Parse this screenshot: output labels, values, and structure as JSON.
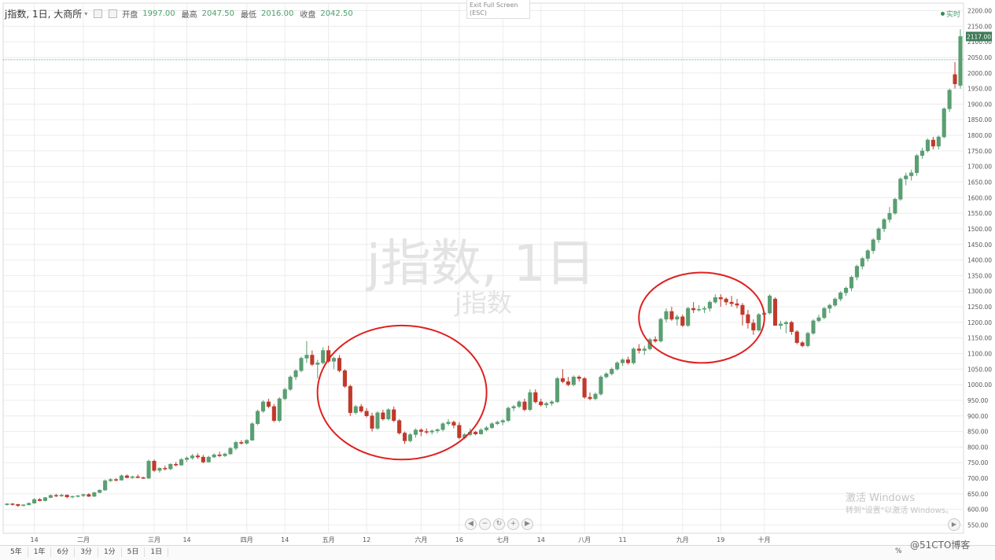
{
  "header": {
    "symbol": "j指数, 1日, 大商所",
    "open_label": "开盘",
    "open_value": "1997.00",
    "high_label": "最高",
    "high_value": "2047.50",
    "low_label": "最低",
    "low_value": "2016.00",
    "close_label": "收盘",
    "close_value": "2042.50"
  },
  "exit_fullscreen": {
    "line1": "Exit Full Screen",
    "line2": "(ESC)"
  },
  "realtime_label": "实时",
  "watermark": {
    "main": "j指数, 1日",
    "sub": "j指数"
  },
  "last_price_label": "2117.00",
  "timeframes": [
    "5年",
    "1年",
    "6分",
    "3分",
    "1分",
    "5日",
    "1日"
  ],
  "percent_label": "%",
  "windows_activation": {
    "line1": "激活 Windows",
    "line2": "转到\"设置\"以激活 Windows。"
  },
  "blog_watermark": "@51CTO博客",
  "colors": {
    "up": "#5a9e72",
    "down": "#c0392b",
    "circle": "#e02020",
    "grid": "#ececec",
    "last_line": "#6aaea0"
  },
  "chart_data": {
    "type": "candlestick",
    "title": "j指数, 1日, 大商所",
    "ylim": [
      540,
      2210
    ],
    "y_ticks": [
      550,
      600,
      650,
      700,
      750,
      800,
      850,
      900,
      950,
      1000,
      1050,
      1100,
      1150,
      1200,
      1250,
      1300,
      1350,
      1400,
      1450,
      1500,
      1550,
      1600,
      1650,
      1700,
      1750,
      1800,
      1850,
      1900,
      1950,
      2000,
      2050,
      2100,
      2150,
      2200
    ],
    "y_tick_labels": [
      "550.00",
      "600.00",
      "650.00",
      "700.00",
      "750.00",
      "800.00",
      "850.00",
      "900.00",
      "950.00",
      "1000.00",
      "1050.00",
      "1100.00",
      "1150.00",
      "1200.00",
      "1250.00",
      "1300.00",
      "1350.00",
      "1400.00",
      "1450.00",
      "1500.00",
      "1550.00",
      "1600.00",
      "1650.00",
      "1700.00",
      "1750.00",
      "1800.00",
      "1850.00",
      "1900.00",
      "1950.00",
      "2000.00",
      "2050.00",
      "2100.00",
      "2150.00",
      "2200.00"
    ],
    "x_labels": [
      {
        "label": "14",
        "bar": 5
      },
      {
        "label": "二月",
        "bar": 14
      },
      {
        "label": "三月",
        "bar": 27
      },
      {
        "label": "14",
        "bar": 33
      },
      {
        "label": "四月",
        "bar": 44
      },
      {
        "label": "14",
        "bar": 51
      },
      {
        "label": "五月",
        "bar": 59
      },
      {
        "label": "12",
        "bar": 66
      },
      {
        "label": "六月",
        "bar": 76
      },
      {
        "label": "16",
        "bar": 83
      },
      {
        "label": "七月",
        "bar": 91
      },
      {
        "label": "14",
        "bar": 98
      },
      {
        "label": "八月",
        "bar": 106
      },
      {
        "label": "11",
        "bar": 113
      },
      {
        "label": "九月",
        "bar": 124
      },
      {
        "label": "19",
        "bar": 131
      },
      {
        "label": "十月",
        "bar": 139
      }
    ],
    "last_price": 2117,
    "reference_line": 2042.5,
    "candles": [
      [
        615,
        620,
        612,
        618
      ],
      [
        618,
        620,
        612,
        616
      ],
      [
        616,
        618,
        608,
        612
      ],
      [
        612,
        616,
        610,
        615
      ],
      [
        615,
        622,
        612,
        620
      ],
      [
        620,
        636,
        618,
        632
      ],
      [
        632,
        636,
        626,
        628
      ],
      [
        628,
        640,
        626,
        638
      ],
      [
        638,
        648,
        636,
        645
      ],
      [
        645,
        650,
        640,
        643
      ],
      [
        643,
        650,
        640,
        646
      ],
      [
        646,
        648,
        636,
        640
      ],
      [
        640,
        644,
        636,
        642
      ],
      [
        642,
        646,
        638,
        644
      ],
      [
        644,
        650,
        640,
        648
      ],
      [
        648,
        652,
        640,
        642
      ],
      [
        642,
        656,
        640,
        654
      ],
      [
        654,
        664,
        652,
        662
      ],
      [
        662,
        696,
        660,
        692
      ],
      [
        692,
        700,
        688,
        696
      ],
      [
        696,
        700,
        690,
        694
      ],
      [
        694,
        712,
        692,
        708
      ],
      [
        708,
        712,
        700,
        702
      ],
      [
        702,
        708,
        698,
        705
      ],
      [
        705,
        712,
        700,
        702
      ],
      [
        702,
        705,
        698,
        700
      ],
      [
        700,
        760,
        698,
        755
      ],
      [
        755,
        760,
        720,
        725
      ],
      [
        725,
        735,
        718,
        732
      ],
      [
        732,
        740,
        725,
        730
      ],
      [
        730,
        748,
        726,
        745
      ],
      [
        745,
        752,
        738,
        742
      ],
      [
        742,
        765,
        740,
        760
      ],
      [
        760,
        770,
        752,
        765
      ],
      [
        765,
        778,
        760,
        772
      ],
      [
        772,
        780,
        762,
        768
      ],
      [
        768,
        775,
        748,
        752
      ],
      [
        752,
        772,
        750,
        768
      ],
      [
        768,
        780,
        765,
        775
      ],
      [
        775,
        785,
        768,
        772
      ],
      [
        772,
        782,
        768,
        778
      ],
      [
        778,
        800,
        775,
        796
      ],
      [
        796,
        820,
        790,
        815
      ],
      [
        815,
        822,
        808,
        812
      ],
      [
        812,
        825,
        808,
        822
      ],
      [
        822,
        880,
        820,
        875
      ],
      [
        875,
        920,
        870,
        915
      ],
      [
        915,
        950,
        910,
        945
      ],
      [
        945,
        955,
        925,
        930
      ],
      [
        930,
        938,
        880,
        885
      ],
      [
        885,
        960,
        880,
        955
      ],
      [
        955,
        990,
        950,
        985
      ],
      [
        985,
        1030,
        980,
        1025
      ],
      [
        1025,
        1050,
        1015,
        1045
      ],
      [
        1045,
        1090,
        1040,
        1085
      ],
      [
        1085,
        1140,
        1070,
        1095
      ],
      [
        1095,
        1110,
        1060,
        1065
      ],
      [
        1065,
        1080,
        1020,
        1070
      ],
      [
        1070,
        1120,
        1065,
        1110
      ],
      [
        1110,
        1125,
        1070,
        1075
      ],
      [
        1075,
        1090,
        1050,
        1085
      ],
      [
        1085,
        1095,
        1040,
        1045
      ],
      [
        1045,
        1050,
        990,
        995
      ],
      [
        995,
        1000,
        900,
        910
      ],
      [
        910,
        935,
        905,
        930
      ],
      [
        930,
        938,
        910,
        915
      ],
      [
        915,
        925,
        895,
        900
      ],
      [
        900,
        910,
        850,
        860
      ],
      [
        860,
        915,
        855,
        910
      ],
      [
        910,
        920,
        885,
        890
      ],
      [
        890,
        925,
        885,
        920
      ],
      [
        920,
        930,
        880,
        885
      ],
      [
        885,
        890,
        840,
        845
      ],
      [
        845,
        850,
        810,
        820
      ],
      [
        820,
        845,
        815,
        840
      ],
      [
        840,
        860,
        830,
        855
      ],
      [
        855,
        860,
        835,
        850
      ],
      [
        850,
        860,
        842,
        848
      ],
      [
        848,
        856,
        840,
        852
      ],
      [
        852,
        860,
        845,
        856
      ],
      [
        856,
        880,
        850,
        875
      ],
      [
        875,
        890,
        868,
        880
      ],
      [
        880,
        885,
        860,
        870
      ],
      [
        870,
        880,
        825,
        830
      ],
      [
        830,
        845,
        825,
        840
      ],
      [
        840,
        860,
        835,
        848
      ],
      [
        848,
        852,
        838,
        842
      ],
      [
        842,
        860,
        840,
        855
      ],
      [
        855,
        868,
        850,
        862
      ],
      [
        862,
        880,
        858,
        875
      ],
      [
        875,
        885,
        870,
        880
      ],
      [
        880,
        890,
        870,
        885
      ],
      [
        885,
        930,
        880,
        925
      ],
      [
        925,
        935,
        915,
        930
      ],
      [
        930,
        950,
        925,
        945
      ],
      [
        945,
        955,
        915,
        920
      ],
      [
        920,
        985,
        915,
        975
      ],
      [
        975,
        985,
        940,
        945
      ],
      [
        945,
        955,
        930,
        935
      ],
      [
        935,
        945,
        925,
        940
      ],
      [
        940,
        950,
        932,
        945
      ],
      [
        945,
        1025,
        942,
        1020
      ],
      [
        1020,
        1050,
        1005,
        1010
      ],
      [
        1010,
        1025,
        995,
        1000
      ],
      [
        1000,
        1030,
        995,
        1025
      ],
      [
        1025,
        1030,
        1010,
        1020
      ],
      [
        1020,
        1025,
        955,
        960
      ],
      [
        960,
        975,
        950,
        955
      ],
      [
        955,
        975,
        950,
        970
      ],
      [
        970,
        1030,
        965,
        1025
      ],
      [
        1025,
        1040,
        1020,
        1035
      ],
      [
        1035,
        1055,
        1030,
        1050
      ],
      [
        1050,
        1075,
        1045,
        1070
      ],
      [
        1070,
        1085,
        1060,
        1080
      ],
      [
        1080,
        1090,
        1065,
        1070
      ],
      [
        1070,
        1120,
        1065,
        1115
      ],
      [
        1115,
        1130,
        1100,
        1110
      ],
      [
        1110,
        1125,
        1095,
        1115
      ],
      [
        1115,
        1150,
        1110,
        1145
      ],
      [
        1145,
        1155,
        1135,
        1140
      ],
      [
        1140,
        1215,
        1135,
        1210
      ],
      [
        1210,
        1245,
        1200,
        1235
      ],
      [
        1235,
        1250,
        1205,
        1210
      ],
      [
        1210,
        1225,
        1190,
        1218
      ],
      [
        1218,
        1225,
        1185,
        1190
      ],
      [
        1190,
        1250,
        1185,
        1245
      ],
      [
        1245,
        1265,
        1230,
        1240
      ],
      [
        1240,
        1255,
        1235,
        1242
      ],
      [
        1242,
        1252,
        1230,
        1245
      ],
      [
        1245,
        1270,
        1235,
        1265
      ],
      [
        1265,
        1290,
        1260,
        1280
      ],
      [
        1280,
        1290,
        1250,
        1275
      ],
      [
        1275,
        1280,
        1255,
        1265
      ],
      [
        1265,
        1285,
        1250,
        1260
      ],
      [
        1260,
        1275,
        1245,
        1255
      ],
      [
        1255,
        1262,
        1190,
        1225
      ],
      [
        1225,
        1240,
        1180,
        1198
      ],
      [
        1198,
        1210,
        1160,
        1175
      ],
      [
        1175,
        1230,
        1170,
        1225
      ],
      [
        1225,
        1235,
        1210,
        1230
      ],
      [
        1230,
        1290,
        1225,
        1285
      ],
      [
        1275,
        1280,
        1195,
        1190
      ],
      [
        1190,
        1205,
        1178,
        1195
      ],
      [
        1195,
        1205,
        1165,
        1200
      ],
      [
        1200,
        1205,
        1160,
        1170
      ],
      [
        1170,
        1175,
        1130,
        1135
      ],
      [
        1135,
        1140,
        1120,
        1125
      ],
      [
        1125,
        1170,
        1120,
        1165
      ],
      [
        1165,
        1210,
        1160,
        1205
      ],
      [
        1205,
        1225,
        1200,
        1215
      ],
      [
        1215,
        1250,
        1210,
        1245
      ],
      [
        1245,
        1260,
        1230,
        1255
      ],
      [
        1255,
        1280,
        1250,
        1275
      ],
      [
        1275,
        1300,
        1268,
        1295
      ],
      [
        1295,
        1315,
        1285,
        1310
      ],
      [
        1310,
        1350,
        1300,
        1345
      ],
      [
        1345,
        1385,
        1335,
        1380
      ],
      [
        1380,
        1410,
        1370,
        1405
      ],
      [
        1405,
        1435,
        1395,
        1430
      ],
      [
        1430,
        1470,
        1420,
        1465
      ],
      [
        1465,
        1505,
        1455,
        1500
      ],
      [
        1500,
        1535,
        1490,
        1530
      ],
      [
        1530,
        1570,
        1520,
        1550
      ],
      [
        1550,
        1600,
        1545,
        1595
      ],
      [
        1595,
        1665,
        1590,
        1660
      ],
      [
        1660,
        1680,
        1640,
        1670
      ],
      [
        1670,
        1690,
        1655,
        1680
      ],
      [
        1680,
        1740,
        1670,
        1735
      ],
      [
        1735,
        1760,
        1725,
        1750
      ],
      [
        1750,
        1790,
        1745,
        1785
      ],
      [
        1785,
        1795,
        1755,
        1765
      ],
      [
        1765,
        1800,
        1755,
        1795
      ],
      [
        1795,
        1890,
        1790,
        1885
      ],
      [
        1885,
        1950,
        1875,
        1945
      ],
      [
        1995,
        2035,
        1950,
        1965
      ],
      [
        1960,
        2140,
        1950,
        2117
      ]
    ],
    "highlight_circles": [
      {
        "from_bar": 59,
        "to_bar": 86,
        "low": 760,
        "high": 1190
      },
      {
        "from_bar": 118,
        "to_bar": 137,
        "low": 1070,
        "high": 1360
      }
    ]
  }
}
